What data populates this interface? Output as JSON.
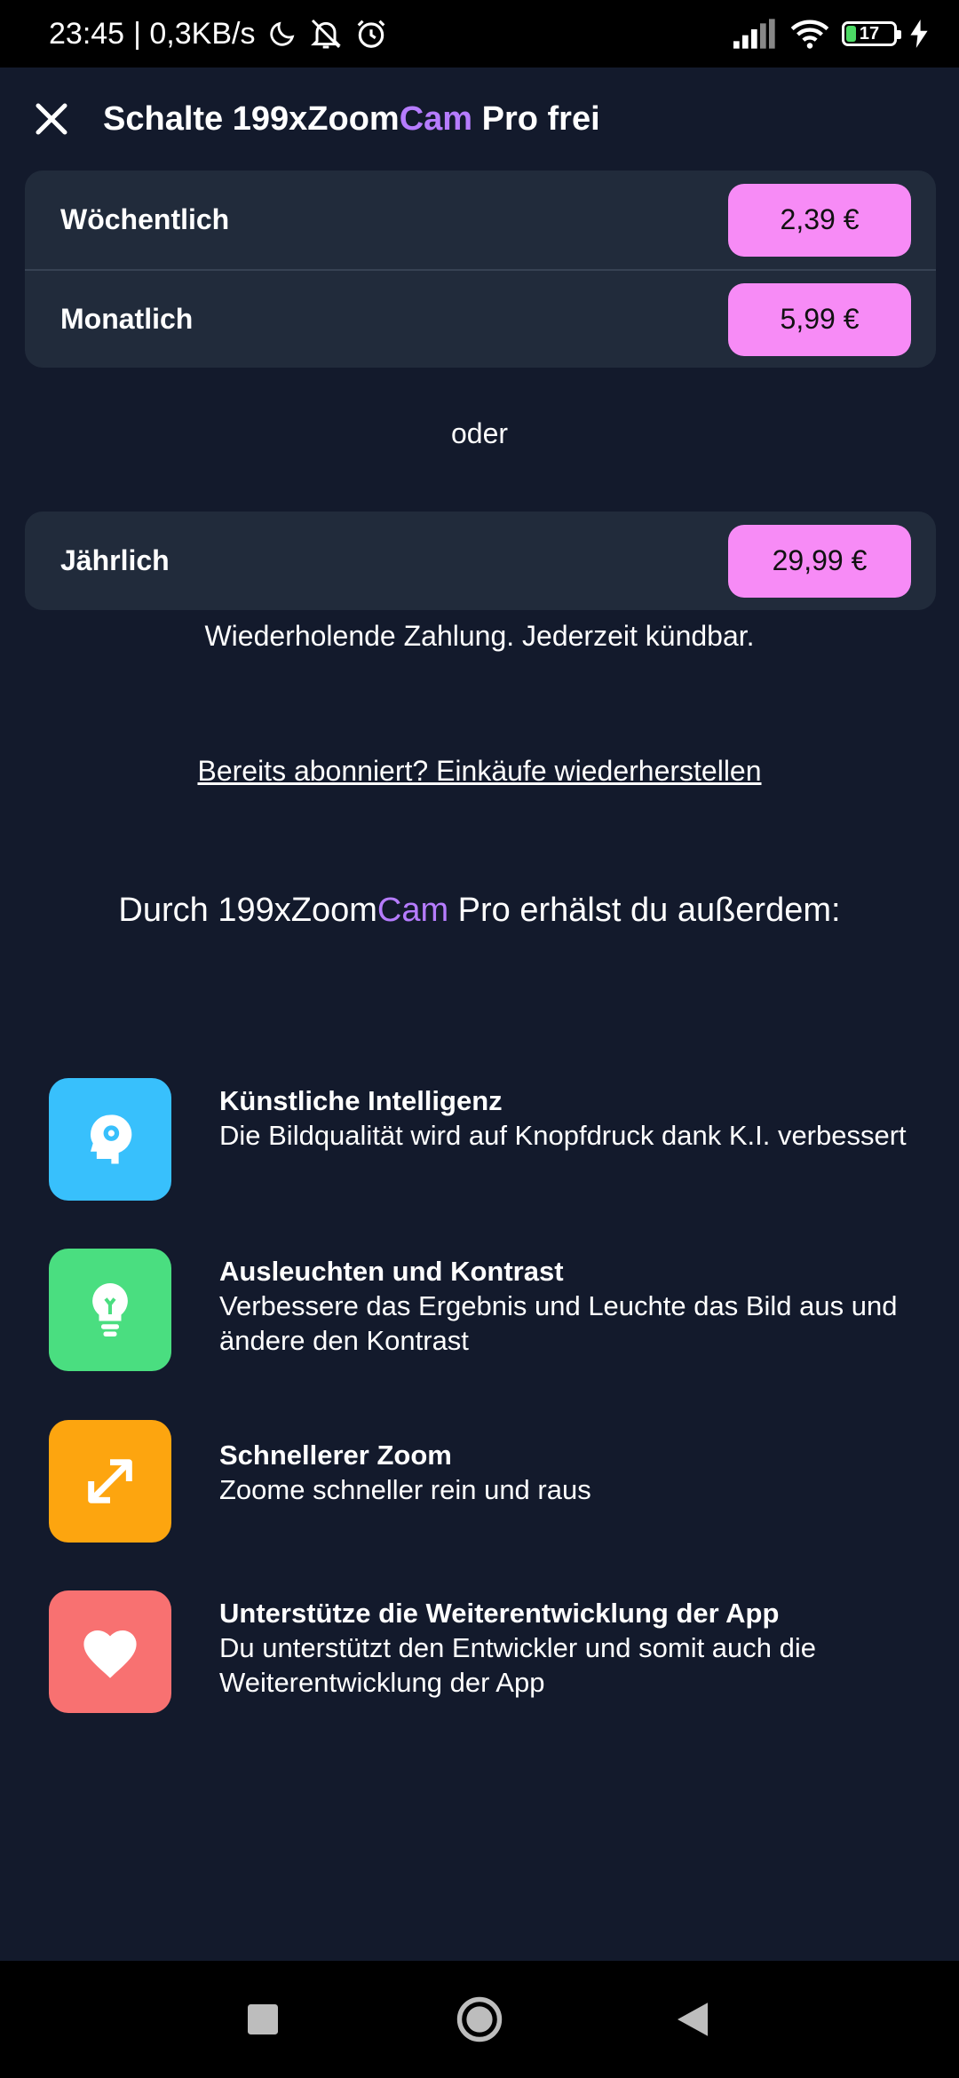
{
  "status_bar": {
    "time": "23:45",
    "speed": "| 0,3KB/s",
    "battery": "17"
  },
  "header": {
    "title_prefix": "Schalte 199xZoom",
    "title_accent": "Cam",
    "title_suffix": " Pro frei"
  },
  "plans": [
    {
      "name": "Wöchentlich",
      "price": "2,39 €"
    },
    {
      "name": "Monatlich",
      "price": "5,99 €"
    },
    {
      "name": "Jährlich",
      "price": "29,99 €"
    }
  ],
  "or_text": "oder",
  "recurring_text": "Wiederholende Zahlung. Jederzeit kündbar.",
  "restore_link": "Bereits abonniert? Einkäufe wiederherstellen",
  "benefits": {
    "prefix": "Durch 199xZoom",
    "accent": "Cam",
    "suffix": " Pro erhälst du außerdem:"
  },
  "features": [
    {
      "title": "Künstliche Intelligenz",
      "desc": "Die Bildqualität wird auf Knopfdruck dank K.I. verbessert",
      "icon": "ai-head-icon",
      "color": "#38c0fc"
    },
    {
      "title": "Ausleuchten und Kontrast",
      "desc": "Verbessere das Ergebnis und Leuchte das Bild aus und ändere den Kontrast",
      "icon": "lightbulb-icon",
      "color": "#4ade80"
    },
    {
      "title": "Schnellerer Zoom",
      "desc": "Zoome schneller rein und raus",
      "icon": "expand-arrows-icon",
      "color": "#fda50f"
    },
    {
      "title": "Unterstütze die Weiterentwicklung der App",
      "desc": "Du unterstützt den Entwickler und somit auch die Weiterentwicklung der App",
      "icon": "heart-icon",
      "color": "#f87171"
    }
  ],
  "colors": {
    "background": "#131a2c",
    "card": "#212b3b",
    "price_button": "#f78bf6",
    "accent": "#b67cff"
  }
}
